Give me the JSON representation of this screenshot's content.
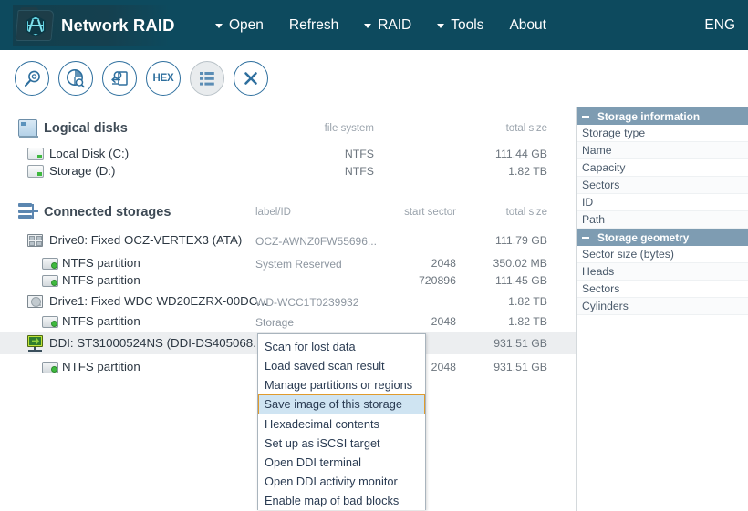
{
  "titlebar": {
    "app_name": "Network RAID",
    "logo_icon": "network-raid-folder-hex-logo",
    "menu": [
      {
        "label": "Open",
        "caret": true
      },
      {
        "label": "Refresh",
        "caret": false
      },
      {
        "label": "RAID",
        "caret": true
      },
      {
        "label": "Tools",
        "caret": true
      },
      {
        "label": "About",
        "caret": false
      }
    ],
    "language": "ENG",
    "bg_color": "#0d4a5e"
  },
  "toolbar": {
    "buttons": [
      {
        "icon": "magnifier-scan-icon",
        "label": "",
        "active": false
      },
      {
        "icon": "pie-chart-search-icon",
        "label": "",
        "active": false
      },
      {
        "icon": "disk-image-export-icon",
        "label": "",
        "active": false
      },
      {
        "icon": "hex-viewer-icon",
        "label": "HEX",
        "active": false
      },
      {
        "icon": "list-view-icon",
        "label": "",
        "active": true
      },
      {
        "icon": "close-x-icon",
        "label": "",
        "active": false
      }
    ]
  },
  "logical_disks": {
    "title": "Logical disks",
    "icon": "logical-disks-monitor-icon",
    "columns": {
      "file_system": "file system",
      "total_size": "total size"
    },
    "rows": [
      {
        "icon": "drive-icon",
        "name": "Local Disk (C:)",
        "file_system": "NTFS",
        "total_size": "111.44 GB"
      },
      {
        "icon": "drive-icon",
        "name": "Storage (D:)",
        "file_system": "NTFS",
        "total_size": "1.82 TB"
      }
    ]
  },
  "connected_storages": {
    "title": "Connected storages",
    "icon": "connected-storages-stack-icon",
    "columns": {
      "label_id": "label/ID",
      "start_sector": "start sector",
      "total_size": "total size"
    },
    "rows": [
      {
        "icon": "ssd-drive-icon",
        "indent": 0,
        "name": "Drive0: Fixed OCZ-VERTEX3 (ATA)",
        "label_id": "OCZ-AWNZ0FW55696...",
        "start_sector": "",
        "total_size": "111.79 GB",
        "selected": false
      },
      {
        "icon": "partition-icon",
        "indent": 1,
        "name": "NTFS partition",
        "label_id": "System Reserved",
        "start_sector": "2048",
        "total_size": "350.02 MB",
        "selected": false
      },
      {
        "icon": "partition-icon",
        "indent": 1,
        "name": "NTFS partition",
        "label_id": "",
        "start_sector": "720896",
        "total_size": "111.45 GB",
        "selected": false
      },
      {
        "icon": "hdd-drive-icon",
        "indent": 0,
        "name": "Drive1: Fixed WDC WD20EZRX-00DC...",
        "label_id": "WD-WCC1T0239932",
        "start_sector": "",
        "total_size": "1.82 TB",
        "selected": false
      },
      {
        "icon": "partition-icon",
        "indent": 1,
        "name": "NTFS partition",
        "label_id": "Storage",
        "start_sector": "2048",
        "total_size": "1.82 TB",
        "selected": false
      },
      {
        "icon": "ddi-network-icon",
        "indent": 0,
        "name": "DDI: ST31000524NS (DDI-DS405068...",
        "label_id": "",
        "start_sector": "",
        "total_size": "931.51 GB",
        "selected": true
      },
      {
        "icon": "partition-icon",
        "indent": 1,
        "name": "NTFS partition",
        "label_id": "",
        "start_sector": "2048",
        "total_size": "931.51 GB",
        "selected": false
      }
    ]
  },
  "context_menu": {
    "items": [
      {
        "label": "Scan for lost data",
        "highlighted": false
      },
      {
        "label": "Load saved scan result",
        "highlighted": false
      },
      {
        "label": "Manage partitions or regions",
        "highlighted": false
      },
      {
        "label": "Save image of this storage",
        "highlighted": true
      },
      {
        "label": "Hexadecimal contents",
        "highlighted": false
      },
      {
        "label": "Set up as iSCSI target",
        "highlighted": false
      },
      {
        "label": "Open DDI terminal",
        "highlighted": false
      },
      {
        "label": "Open DDI activity monitor",
        "highlighted": false
      },
      {
        "label": "Enable map of bad blocks",
        "highlighted": false
      }
    ],
    "highlight_fill": "#cfe4f2",
    "highlight_border": "#e09b2d"
  },
  "right_panel": {
    "sections": [
      {
        "title": "Storage information",
        "collapse_icon": "minus-icon",
        "rows": [
          "Storage type",
          "Name",
          "Capacity",
          "Sectors",
          "ID",
          "Path"
        ]
      },
      {
        "title": "Storage geometry",
        "collapse_icon": "minus-icon",
        "rows": [
          "Sector size (bytes)",
          "Heads",
          "Sectors",
          "Cylinders"
        ]
      }
    ],
    "header_color": "#7e9cb2"
  }
}
